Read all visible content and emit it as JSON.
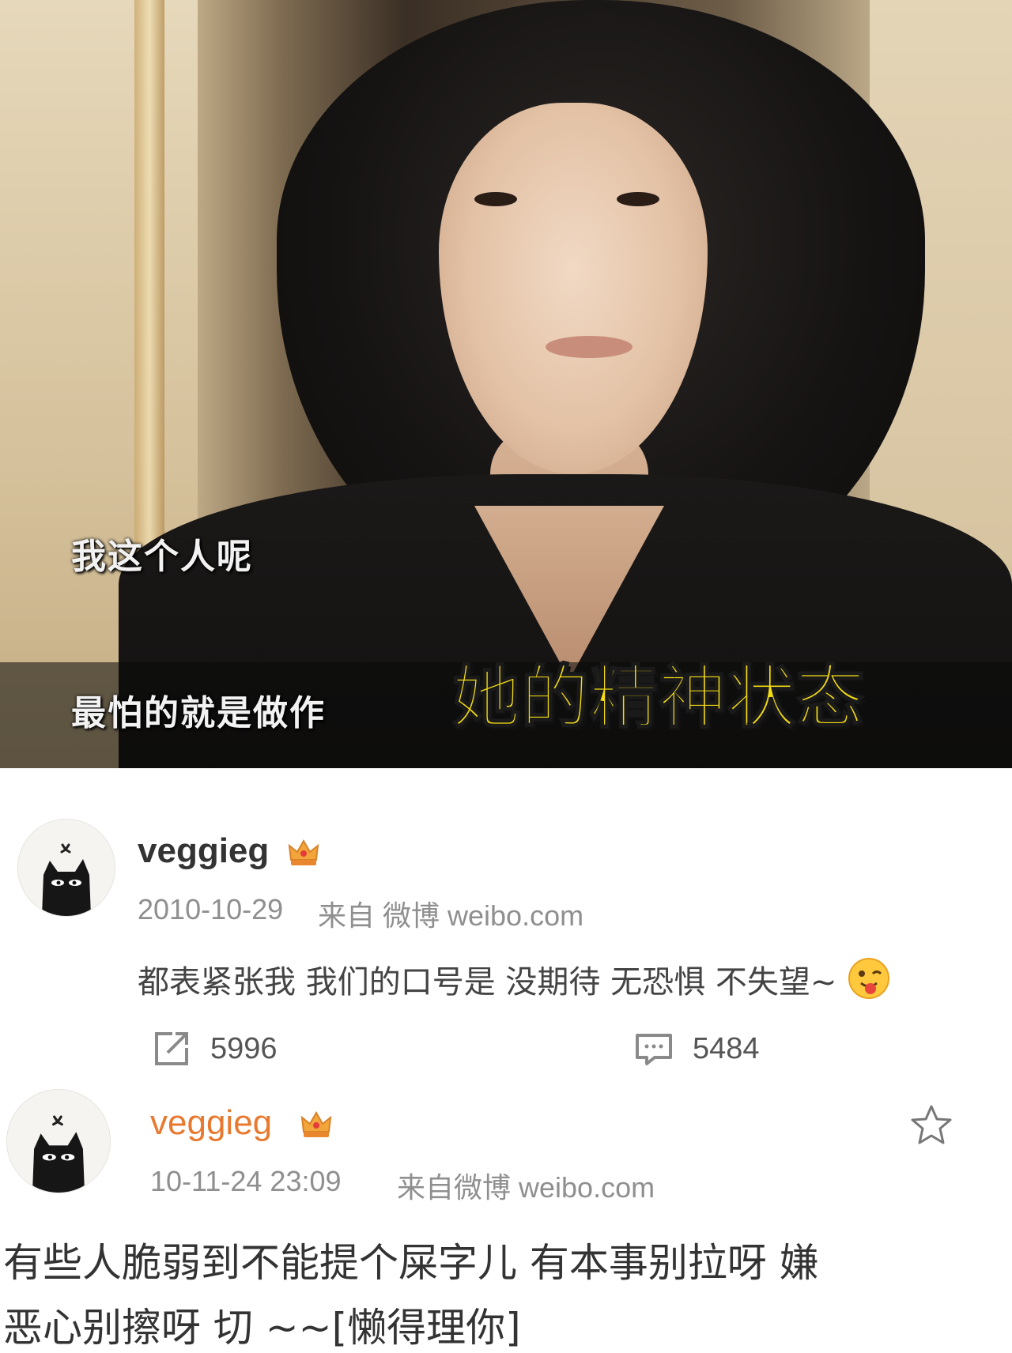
{
  "video_still": {
    "subtitle_line_1": "我这个人呢",
    "subtitle_line_2": "最怕的就是做作",
    "caption": "她的精神状态",
    "caption_color": "#F5DD12"
  },
  "comments": [
    {
      "username": "veggieg",
      "username_color": "#333333",
      "badge": "crown-badge-icon",
      "date": "2010-10-29",
      "source": "来自 微博 weibo.com",
      "text": "都表紧张我 我们的口号是 没期待 无恐惧 不失望~",
      "emoji": "tongue-out-emoji-icon",
      "repost_count": "5996",
      "comment_count": "5484"
    },
    {
      "username": "veggieg",
      "username_color": "#E8792F",
      "badge": "crown-badge-icon",
      "date": "10-11-24 23:09",
      "source": "来自微博 weibo.com",
      "text_line_1": "有些人脆弱到不能提个屎字儿 有本事别拉呀 嫌",
      "text_line_2": "恶心别擦呀 切 ~~[懒得理你]",
      "favorite_icon": "star-icon"
    }
  ]
}
